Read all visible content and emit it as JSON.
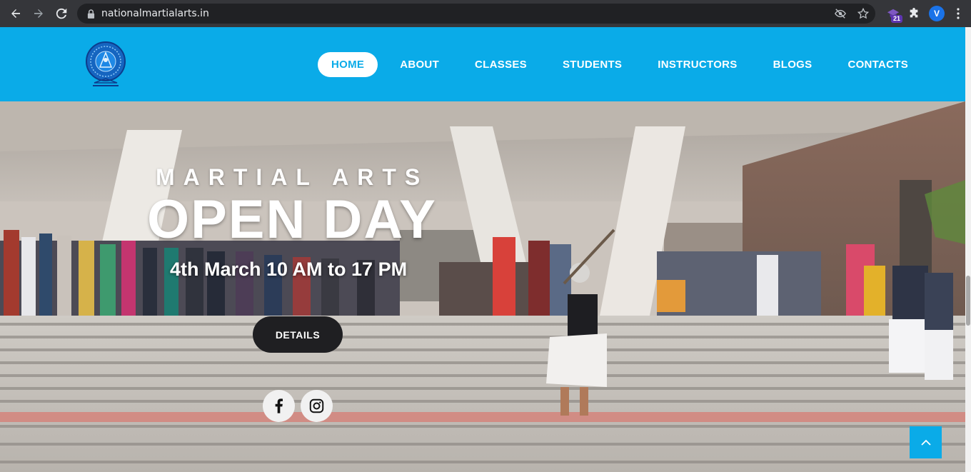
{
  "browser": {
    "url": "nationalmartialarts.in",
    "extension_badge": "21",
    "profile_initial": "V",
    "icons": [
      "back-arrow-icon",
      "forward-arrow-icon",
      "reload-icon",
      "lock-icon",
      "eye-off-icon",
      "star-icon",
      "graduation-cap-icon",
      "puzzle-icon",
      "kebab-menu-icon"
    ]
  },
  "site": {
    "brand_color": "#0aabe8",
    "logo_icon": "national-martial-arts-emblem-icon",
    "menu": [
      {
        "label": "HOME",
        "active": true
      },
      {
        "label": "ABOUT",
        "active": false
      },
      {
        "label": "CLASSES",
        "active": false
      },
      {
        "label": "STUDENTS",
        "active": false
      },
      {
        "label": "INSTRUCTORS",
        "active": false
      },
      {
        "label": "BLOGS",
        "active": false
      },
      {
        "label": "CONTACTS",
        "active": false
      }
    ]
  },
  "hero": {
    "eyebrow": "MARTIAL ARTS",
    "headline": "OPEN DAY",
    "dateline": "4th March 10 AM to 17 PM",
    "details_label": "DETAILS",
    "social_icons": [
      "facebook-icon",
      "instagram-icon"
    ],
    "back_to_top_icon": "chevron-up-icon"
  }
}
